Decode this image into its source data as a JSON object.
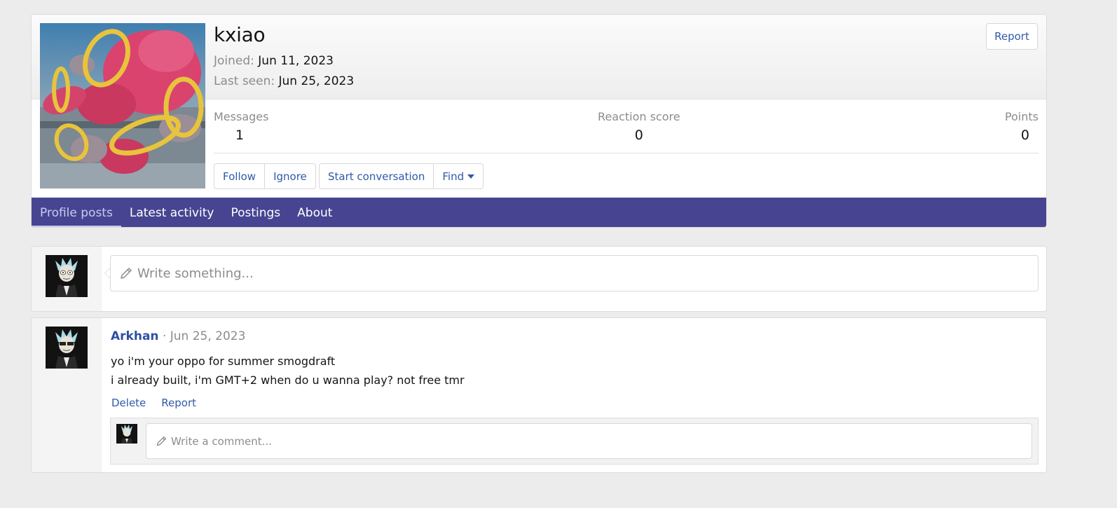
{
  "profile": {
    "username": "kxiao",
    "joined_label": "Joined:",
    "joined_value": "Jun 11, 2023",
    "last_seen_label": "Last seen:",
    "last_seen_value": "Jun 25, 2023",
    "report_label": "Report",
    "stats": {
      "messages_label": "Messages",
      "messages_value": "1",
      "reaction_label": "Reaction score",
      "reaction_value": "0",
      "points_label": "Points",
      "points_value": "0"
    },
    "buttons": {
      "follow": "Follow",
      "ignore": "Ignore",
      "start_conversation": "Start conversation",
      "find": "Find"
    }
  },
  "tabs": [
    {
      "label": "Profile posts",
      "active": true
    },
    {
      "label": "Latest activity",
      "active": false
    },
    {
      "label": "Postings",
      "active": false
    },
    {
      "label": "About",
      "active": false
    }
  ],
  "composer": {
    "placeholder": "Write something..."
  },
  "post": {
    "author": "Arkhan",
    "separator": "·",
    "date": "Jun 25, 2023",
    "line1": "yo i'm your oppo for summer smogdraft",
    "line2": "i already built, i'm GMT+2 when do u wanna play? not free tmr",
    "delete_label": "Delete",
    "report_label": "Report",
    "comment_placeholder": "Write a comment..."
  },
  "icons": {
    "composer_icon": "pencil-icon",
    "comment_icon": "pencil-icon",
    "find_caret": "caret-down-icon"
  },
  "colors": {
    "tab_bar": "#474591",
    "link": "#2f5aa8",
    "author": "#2f4fa3",
    "background": "#ececec"
  }
}
